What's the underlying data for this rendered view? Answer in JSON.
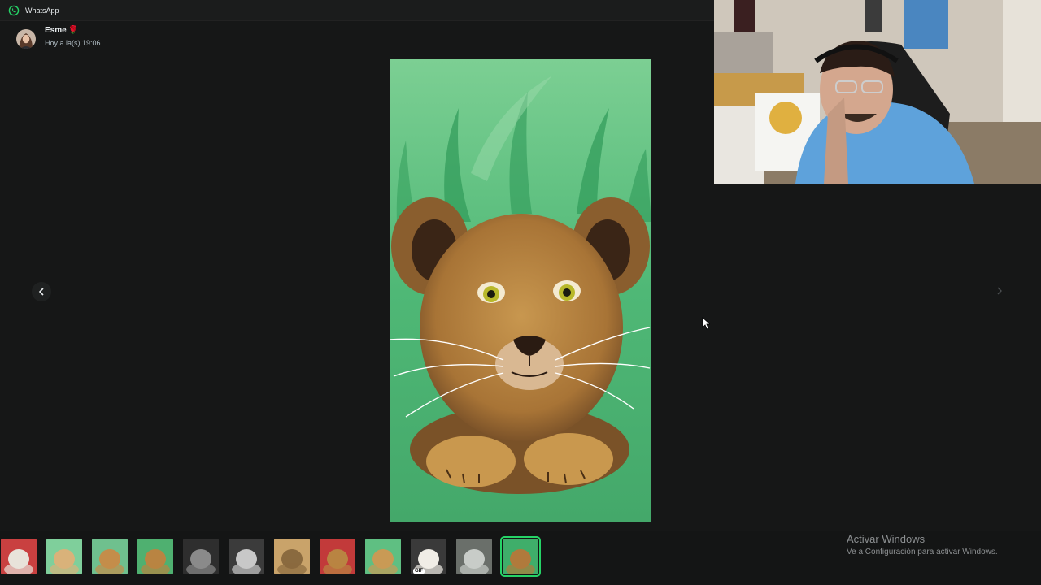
{
  "window": {
    "title": "WhatsApp"
  },
  "header": {
    "sender_name": "Esme",
    "sender_emoji": "🌹",
    "timestamp": "Hoy a la(s) 19:06"
  },
  "viewer": {
    "image": "lion-cub-painting",
    "prev_icon": "chevron-left-icon",
    "next_icon": "chevron-right-icon"
  },
  "thumbnails": [
    {
      "name": "photo-1"
    },
    {
      "name": "photo-2"
    },
    {
      "name": "photo-3"
    },
    {
      "name": "photo-4"
    },
    {
      "name": "photo-5"
    },
    {
      "name": "photo-6"
    },
    {
      "name": "photo-7"
    },
    {
      "name": "photo-8"
    },
    {
      "name": "photo-9"
    },
    {
      "name": "gif-10",
      "badge": "GIF"
    },
    {
      "name": "photo-11"
    },
    {
      "name": "photo-12",
      "active": true
    }
  ],
  "watermark": {
    "line1": "Activar Windows",
    "line2": "Ve a Configuración para activar Windows."
  },
  "colors": {
    "accent": "#25d366",
    "background": "#161717"
  }
}
